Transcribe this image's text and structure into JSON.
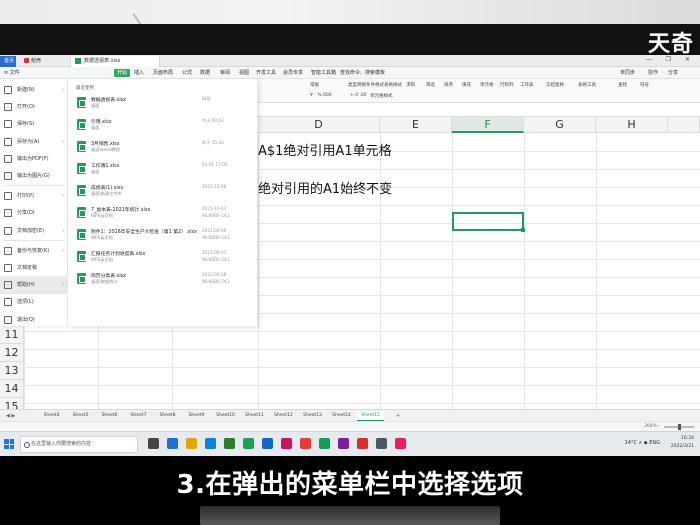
{
  "watermark": "天奇",
  "titlebar": {
    "home_tab": "首页",
    "wps_tab": "稻壳",
    "doc_tab": "数据透视表.xlsx",
    "window_controls": "— ❐ ✕"
  },
  "menu": {
    "file": "≡ 文件",
    "items": [
      "开始",
      "插入",
      "页面布局",
      "公式",
      "数据",
      "审阅",
      "视图",
      "开发工具",
      "会员专享",
      "智能工具箱",
      "查找命令、搜索模板"
    ],
    "active_index": 0,
    "right": [
      "未同步",
      "协作",
      "分享"
    ]
  },
  "toolbar": {
    "top_labels": [
      "常规",
      "类型转换",
      "条件格式",
      "表格样式",
      "求和",
      "筛选",
      "排序",
      "填充",
      "单元格",
      "行和列",
      "工作表",
      "冻结窗格",
      "表格工具",
      "查找",
      "符号"
    ],
    "bottom_labels": [
      "¥ - % 000",
      "+.0 .00",
      "单元格样式"
    ]
  },
  "grid": {
    "columns": [
      {
        "label": "D"
      },
      {
        "label": "E"
      },
      {
        "label": "F",
        "selected": true
      },
      {
        "label": "G"
      },
      {
        "label": "H"
      }
    ],
    "rows": [
      "11",
      "12",
      "13",
      "14",
      "15"
    ],
    "cell_texts": [
      "A$1绝对引用A1单元格",
      "绝对引用的A1始终不变"
    ]
  },
  "file_menu": {
    "items": [
      {
        "icon": "new-icon",
        "label": "新建(N)",
        "arrow": true
      },
      {
        "icon": "open-icon",
        "label": "打开(O)",
        "arrow": false
      },
      {
        "icon": "save-icon",
        "label": "保存(S)",
        "arrow": false
      },
      {
        "icon": "save-as-icon",
        "label": "另存为(A)",
        "arrow": true
      },
      {
        "icon": "pdf-icon",
        "label": "输出为PDF(F)",
        "arrow": false
      },
      {
        "icon": "image-icon",
        "label": "输出为图片(G)",
        "arrow": false
      },
      {
        "icon": "print-icon",
        "label": "打印(P)",
        "arrow": true
      },
      {
        "icon": "share-icon",
        "label": "分享(D)",
        "arrow": false
      },
      {
        "icon": "encrypt-icon",
        "label": "文档加密(E)",
        "arrow": true
      },
      {
        "icon": "backup-icon",
        "label": "备份与恢复(K)",
        "arrow": true
      },
      {
        "icon": "help-icon-doc",
        "label": "文档定稿",
        "arrow": false
      },
      {
        "icon": "help-icon",
        "label": "帮助(H)",
        "arrow": true,
        "hover": true
      },
      {
        "icon": "options-icon",
        "label": "选项(L)",
        "arrow": false
      },
      {
        "icon": "exit-icon",
        "label": "退出(Q)",
        "arrow": false
      }
    ]
  },
  "recent": {
    "title": "最近使用",
    "files": [
      {
        "name": "数据透视表.xlsx",
        "path": "桌面",
        "time": "刚刚",
        "extra": ""
      },
      {
        "name": "引用.xlsx",
        "path": "桌面",
        "time": "今天 09:02",
        "extra": ""
      },
      {
        "name": "3月销售.xlsx",
        "path": "桌面\\excel教程",
        "time": "昨天 15:40",
        "extra": ""
      },
      {
        "name": "工作簿1.xlsx",
        "path": "桌面",
        "time": "03-01 17:06",
        "extra": ""
      },
      {
        "name": "成绩表(1).xlsx",
        "path": "桌面\\新建文件夹",
        "time": "2021-12-08",
        "extra": ""
      },
      {
        "name": "7_副本表-2021年统计.xlsx",
        "path": "WPS云文档",
        "time": "2021-10-07",
        "extra": "WLNSRE-OCL"
      },
      {
        "name": "附件1：2016年安全生产大检查（第1 第2）.xlsx",
        "path": "WPS云文档",
        "time": "2021-08-09",
        "extra": "WLNSRE-OCL"
      },
      {
        "name": "汇报任务计划进度表.xlsx",
        "path": "WPS云文档",
        "time": "2021-08-01",
        "extra": "WLNSRE-OCL"
      },
      {
        "name": "简历分类表.xlsx",
        "path": "桌面\\数据统计",
        "time": "2021-06-28",
        "extra": "WLNSRE-OCL"
      }
    ]
  },
  "sheets": {
    "tabs": [
      "Sheet4",
      "Sheet5",
      "Sheet6",
      "Sheet7",
      "Sheet8",
      "Sheet9",
      "Sheet10",
      "Sheet11",
      "Sheet12",
      "Sheet13",
      "Sheet14",
      "Sheet15"
    ],
    "active_index": 11,
    "add": "+"
  },
  "statusbar": {
    "zoom": "264% -"
  },
  "taskbar": {
    "search_placeholder": "在这里输入你要搜索的内容",
    "tray_icons": "14°C  ∧  ◆  ENG",
    "time": "16:34",
    "date": "2022/3/21"
  },
  "caption": "3.在弹出的菜单栏中选择选项"
}
